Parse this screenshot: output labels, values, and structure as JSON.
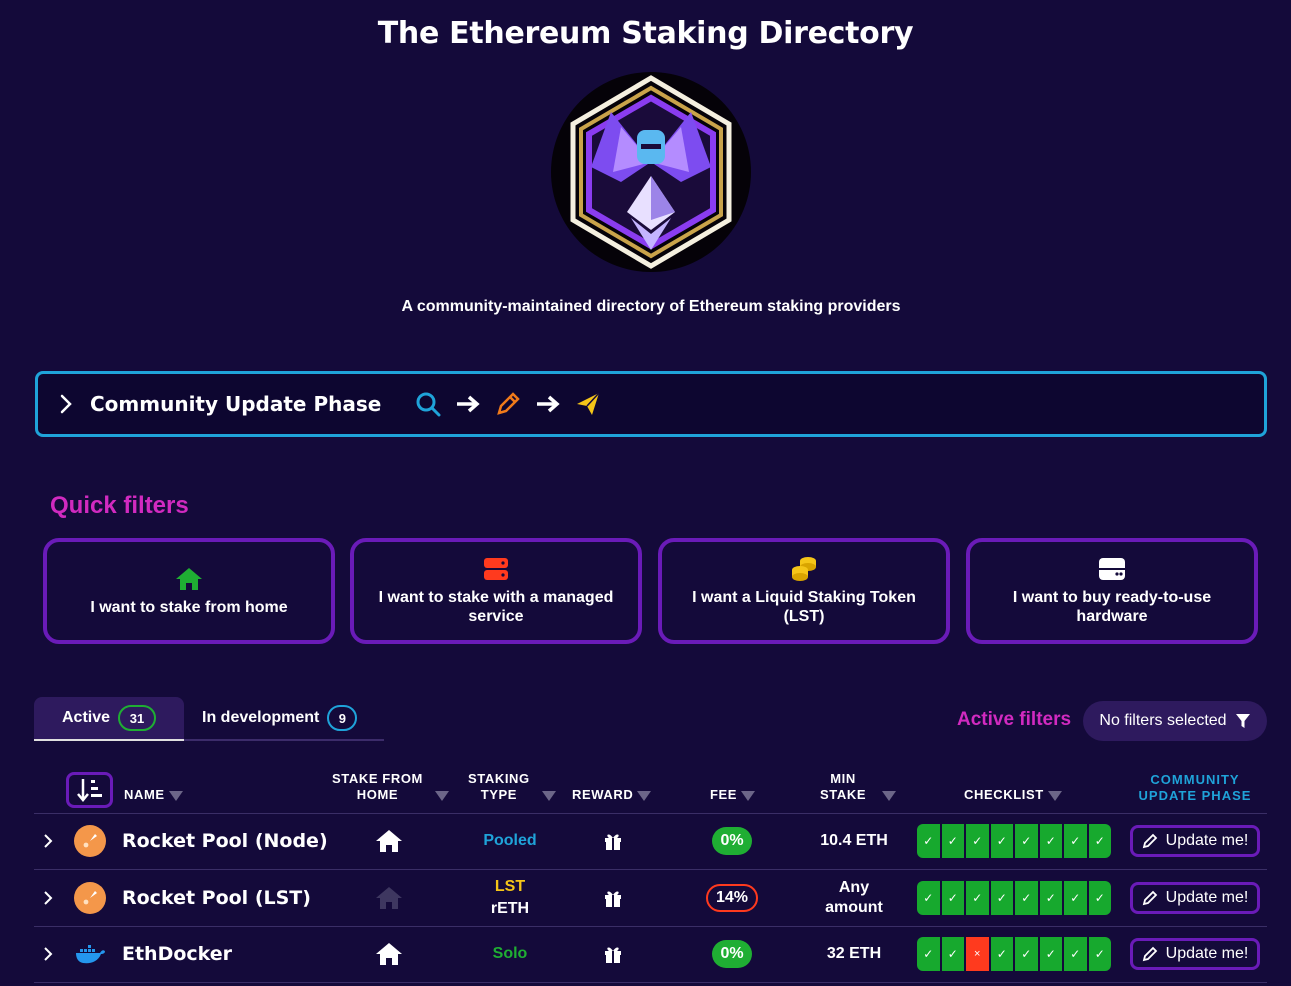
{
  "header": {
    "title": "The Ethereum Staking Directory",
    "subtitle": "A community-maintained directory of Ethereum staking providers"
  },
  "phase": {
    "label": "Community Update Phase",
    "icons": [
      "search-icon",
      "arrow-right-icon",
      "pencil-icon",
      "arrow-right-icon",
      "send-icon"
    ]
  },
  "quick_filters": {
    "title": "Quick filters",
    "cards": [
      {
        "label": "I want to stake from home",
        "icon": "home-icon"
      },
      {
        "label": "I want to stake with a managed service",
        "icon": "server-icon"
      },
      {
        "label": "I want a Liquid Staking Token (LST)",
        "icon": "coins-icon"
      },
      {
        "label": "I want to buy ready-to-use hardware",
        "icon": "hardware-icon"
      }
    ]
  },
  "tabs": [
    {
      "label": "Active",
      "count": "31"
    },
    {
      "label": "In development",
      "count": "9"
    }
  ],
  "active_filters": {
    "label": "Active filters",
    "button": "No filters selected"
  },
  "table": {
    "headers": {
      "name": "NAME",
      "home_1": "STAKE FROM",
      "home_2": "HOME",
      "type_1": "STAKING",
      "type_2": "TYPE",
      "reward": "REWARD",
      "fee": "FEE",
      "min_1": "MIN",
      "min_2": "STAKE",
      "checklist": "CHECKLIST",
      "cup_1": "COMMUNITY",
      "cup_2": "UPDATE PHASE"
    },
    "rows": [
      {
        "name": "Rocket Pool (Node)",
        "type_1": "Pooled",
        "type_2": "",
        "fee": "0%",
        "min_1": "10.4 ETH",
        "min_2": "",
        "update": "Update me!"
      },
      {
        "name": "Rocket Pool (LST)",
        "type_1": "LST",
        "type_2": "rETH",
        "fee": "14%",
        "min_1": "Any",
        "min_2": "amount",
        "update": "Update me!"
      },
      {
        "name": "EthDocker",
        "type_1": "Solo",
        "type_2": "",
        "fee": "0%",
        "min_1": "32 ETH",
        "min_2": "",
        "update": "Update me!"
      }
    ],
    "checklist_marks": {
      "pass": "✓",
      "fail": "×"
    }
  },
  "colors": {
    "background": "#140a3a",
    "accent_purple": "#6a1bb8",
    "accent_magenta": "#d12ac0",
    "accent_blue": "#1fa3d9",
    "pass_green": "#1fae33",
    "fail_red": "#ff3a1e",
    "lst_yellow": "#f5c518"
  }
}
